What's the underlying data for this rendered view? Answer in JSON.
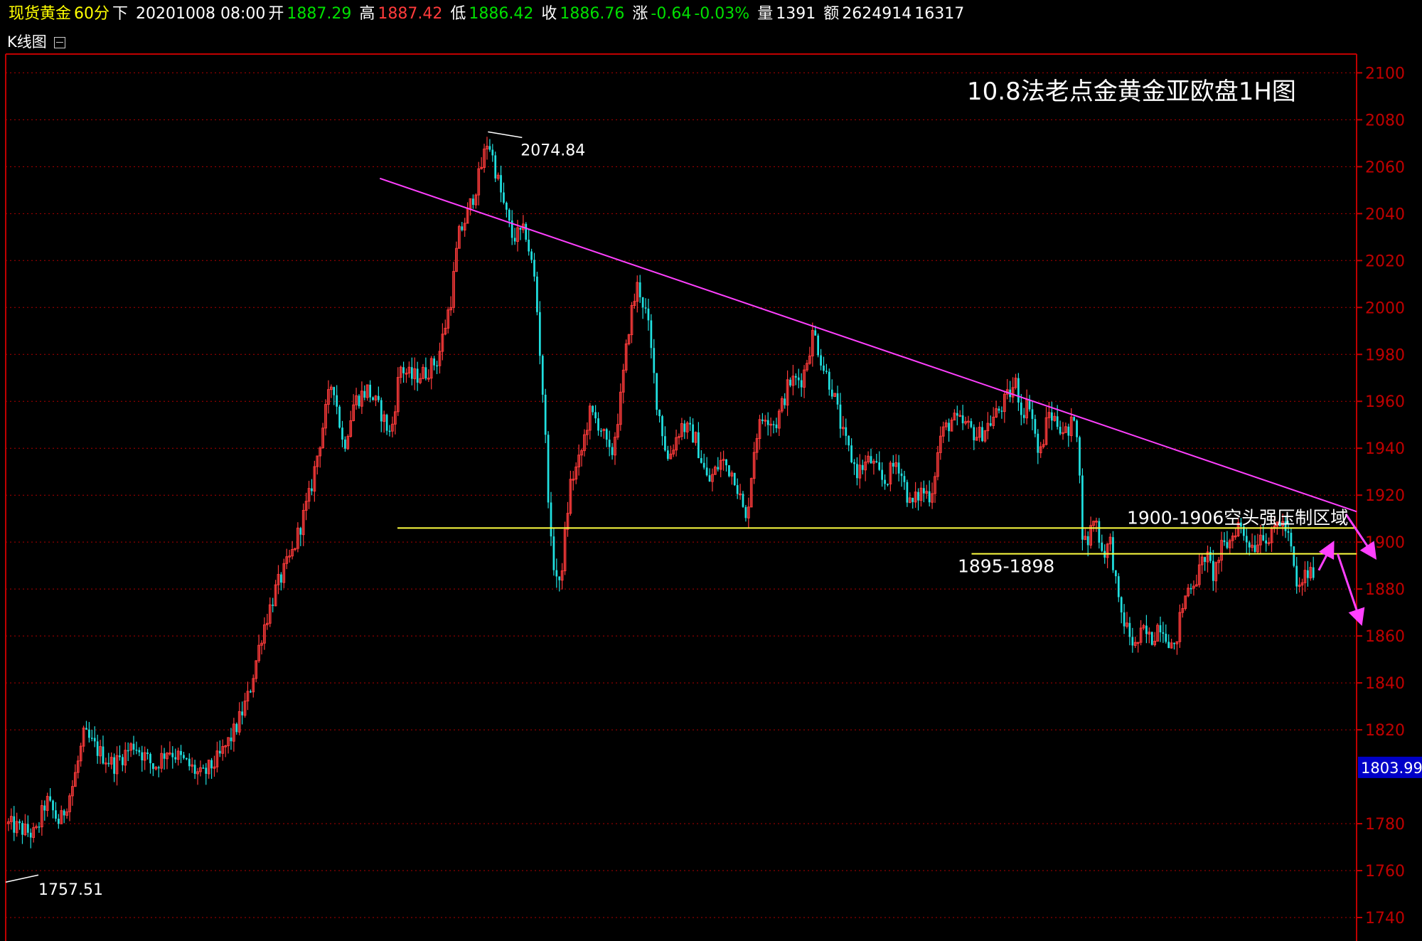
{
  "header": {
    "symbol": "现货黄金",
    "period": "60分",
    "mode": "下",
    "datetime": "20201008 08:00",
    "open_label": "开",
    "open": "1887.29",
    "high_label": "高",
    "high": "1887.42",
    "low_label": "低",
    "low": "1886.42",
    "close_label": "收",
    "close": "1886.76",
    "change_label": "涨",
    "change": "-0.64",
    "change_pct": "-0.03%",
    "volume_label": "量",
    "volume": "1391",
    "amount_label": "额",
    "amount": "2624914",
    "amount_extra": "16317"
  },
  "tab": {
    "label": "K线图"
  },
  "colors": {
    "up": "#ff3b3b",
    "down": "#20e0e0",
    "trendline": "#ff40ff",
    "support": "#ffff40",
    "axis": "#c00000",
    "grid": "#b00000",
    "arrow": "#ff40ff",
    "current_price_bg": "#0000c8"
  },
  "chart_data": {
    "type": "candlestick",
    "title": "10.8法老点金黄金亚欧盘1H图",
    "ylim": [
      1730,
      2108
    ],
    "yticks": [
      2100,
      2080,
      2060,
      2040,
      2020,
      2000,
      1980,
      1960,
      1940,
      1920,
      1900,
      1880,
      1860,
      1840,
      1820,
      1780,
      1760,
      1740
    ],
    "current_price": "1803.99",
    "high_marker": {
      "value": 2074.84,
      "label": "2074.84"
    },
    "low_marker": {
      "value": 1757.51,
      "label": "1757.51"
    },
    "price_path": [
      [
        0,
        1780
      ],
      [
        0.01,
        1778
      ],
      [
        0.022,
        1775
      ],
      [
        0.03,
        1790
      ],
      [
        0.04,
        1780
      ],
      [
        0.05,
        1797
      ],
      [
        0.058,
        1818
      ],
      [
        0.07,
        1810
      ],
      [
        0.08,
        1805
      ],
      [
        0.095,
        1814
      ],
      [
        0.11,
        1804
      ],
      [
        0.12,
        1812
      ],
      [
        0.135,
        1805
      ],
      [
        0.145,
        1800
      ],
      [
        0.158,
        1808
      ],
      [
        0.17,
        1820
      ],
      [
        0.18,
        1835
      ],
      [
        0.19,
        1862
      ],
      [
        0.2,
        1880
      ],
      [
        0.212,
        1895
      ],
      [
        0.225,
        1920
      ],
      [
        0.235,
        1950
      ],
      [
        0.242,
        1970
      ],
      [
        0.25,
        1940
      ],
      [
        0.258,
        1960
      ],
      [
        0.268,
        1965
      ],
      [
        0.278,
        1955
      ],
      [
        0.285,
        1945
      ],
      [
        0.292,
        1975
      ],
      [
        0.3,
        1970
      ],
      [
        0.31,
        1972
      ],
      [
        0.32,
        1978
      ],
      [
        0.33,
        2005
      ],
      [
        0.335,
        2030
      ],
      [
        0.342,
        2040
      ],
      [
        0.35,
        2055
      ],
      [
        0.357,
        2072
      ],
      [
        0.362,
        2060
      ],
      [
        0.368,
        2045
      ],
      [
        0.375,
        2030
      ],
      [
        0.385,
        2032
      ],
      [
        0.392,
        2010
      ],
      [
        0.398,
        1960
      ],
      [
        0.404,
        1895
      ],
      [
        0.41,
        1880
      ],
      [
        0.418,
        1925
      ],
      [
        0.425,
        1935
      ],
      [
        0.432,
        1955
      ],
      [
        0.44,
        1950
      ],
      [
        0.448,
        1935
      ],
      [
        0.455,
        1960
      ],
      [
        0.462,
        1995
      ],
      [
        0.468,
        2010
      ],
      [
        0.475,
        1995
      ],
      [
        0.482,
        1960
      ],
      [
        0.49,
        1935
      ],
      [
        0.5,
        1950
      ],
      [
        0.51,
        1945
      ],
      [
        0.52,
        1925
      ],
      [
        0.53,
        1935
      ],
      [
        0.54,
        1928
      ],
      [
        0.548,
        1908
      ],
      [
        0.555,
        1945
      ],
      [
        0.562,
        1955
      ],
      [
        0.57,
        1950
      ],
      [
        0.58,
        1968
      ],
      [
        0.59,
        1970
      ],
      [
        0.598,
        1990
      ],
      [
        0.605,
        1975
      ],
      [
        0.612,
        1965
      ],
      [
        0.62,
        1945
      ],
      [
        0.63,
        1930
      ],
      [
        0.64,
        1935
      ],
      [
        0.65,
        1925
      ],
      [
        0.66,
        1935
      ],
      [
        0.67,
        1915
      ],
      [
        0.678,
        1922
      ],
      [
        0.685,
        1920
      ],
      [
        0.692,
        1945
      ],
      [
        0.7,
        1952
      ],
      [
        0.71,
        1950
      ],
      [
        0.72,
        1945
      ],
      [
        0.73,
        1952
      ],
      [
        0.74,
        1960
      ],
      [
        0.748,
        1968
      ],
      [
        0.752,
        1955
      ],
      [
        0.758,
        1960
      ],
      [
        0.765,
        1935
      ],
      [
        0.772,
        1955
      ],
      [
        0.78,
        1950
      ],
      [
        0.787,
        1945
      ],
      [
        0.792,
        1958
      ],
      [
        0.797,
        1905
      ],
      [
        0.8,
        1898
      ],
      [
        0.806,
        1912
      ],
      [
        0.812,
        1895
      ],
      [
        0.818,
        1900
      ],
      [
        0.824,
        1872
      ],
      [
        0.83,
        1863
      ],
      [
        0.836,
        1855
      ],
      [
        0.842,
        1862
      ],
      [
        0.848,
        1858
      ],
      [
        0.854,
        1866
      ],
      [
        0.86,
        1860
      ],
      [
        0.865,
        1853
      ],
      [
        0.87,
        1870
      ],
      [
        0.876,
        1882
      ],
      [
        0.882,
        1885
      ],
      [
        0.888,
        1895
      ],
      [
        0.894,
        1886
      ],
      [
        0.9,
        1897
      ],
      [
        0.906,
        1900
      ],
      [
        0.912,
        1908
      ],
      [
        0.918,
        1902
      ],
      [
        0.924,
        1898
      ],
      [
        0.93,
        1905
      ],
      [
        0.936,
        1900
      ],
      [
        0.942,
        1910
      ],
      [
        0.948,
        1905
      ],
      [
        0.952,
        1895
      ],
      [
        0.956,
        1878
      ],
      [
        0.962,
        1886
      ],
      [
        0.968,
        1887
      ]
    ],
    "trendline": {
      "from": [
        0.277,
        2055
      ],
      "to": [
        1.0,
        1913
      ]
    },
    "support_lines": [
      {
        "from_x": 0.29,
        "to_x": 1.0,
        "value": 1906,
        "label": "1900-1906空头强压制区域"
      },
      {
        "from_x": 0.715,
        "to_x": 1.0,
        "value": 1895,
        "label": "1895-1898"
      }
    ],
    "arrows": [
      {
        "from": [
          0.972,
          1888
        ],
        "to": [
          0.982,
          1899
        ]
      },
      {
        "from": [
          0.992,
          1912
        ],
        "to": [
          1.013,
          1894
        ]
      },
      {
        "from": [
          0.986,
          1895
        ],
        "to": [
          1.003,
          1866
        ]
      }
    ]
  }
}
